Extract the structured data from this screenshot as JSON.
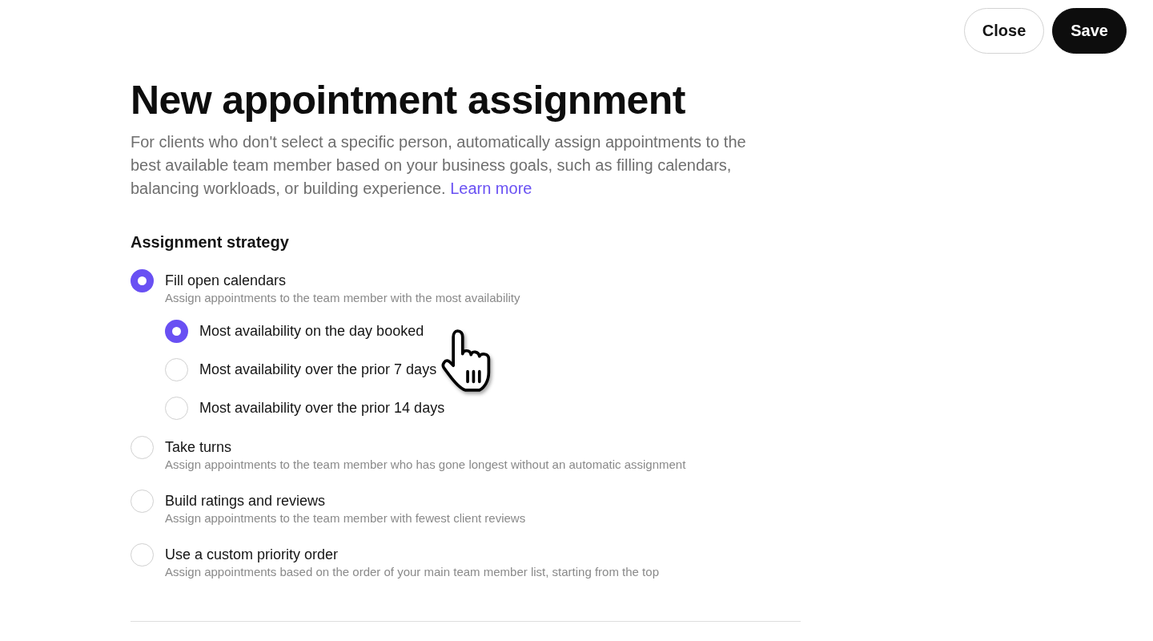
{
  "toolbar": {
    "buttons": [
      {
        "label": "Close",
        "kind": "secondary"
      },
      {
        "label": "Save",
        "kind": "primary"
      }
    ]
  },
  "title": "New appointment assignment",
  "description": {
    "text": "For clients who don't select a specific person, automatically assign appointments to the best available team member based on your business goals, such as filling calendars, balancing workloads, or building experience.",
    "link": "Learn more"
  },
  "assignment_strategy": {
    "heading": "Assignment strategy",
    "options": [
      {
        "label": "Fill open calendars",
        "description": "Assign appointments to the team member with the most availability",
        "selected": true,
        "sub_options": [
          {
            "label": "Most availability on the day booked",
            "selected": true
          },
          {
            "label": "Most availability over the prior 7 days",
            "selected": false
          },
          {
            "label": "Most availability over the prior 14 days",
            "selected": false
          }
        ]
      },
      {
        "label": "Take turns",
        "description": "Assign appointments to the team member who has gone longest without an automatic assignment",
        "selected": false
      },
      {
        "label": "Build ratings and reviews",
        "description": "Assign appointments to the team member with fewest client reviews",
        "selected": false
      },
      {
        "label": "Use a custom priority order",
        "description": "Assign appointments based on the order of your main team member list, starting from the top",
        "selected": false
      }
    ]
  }
}
